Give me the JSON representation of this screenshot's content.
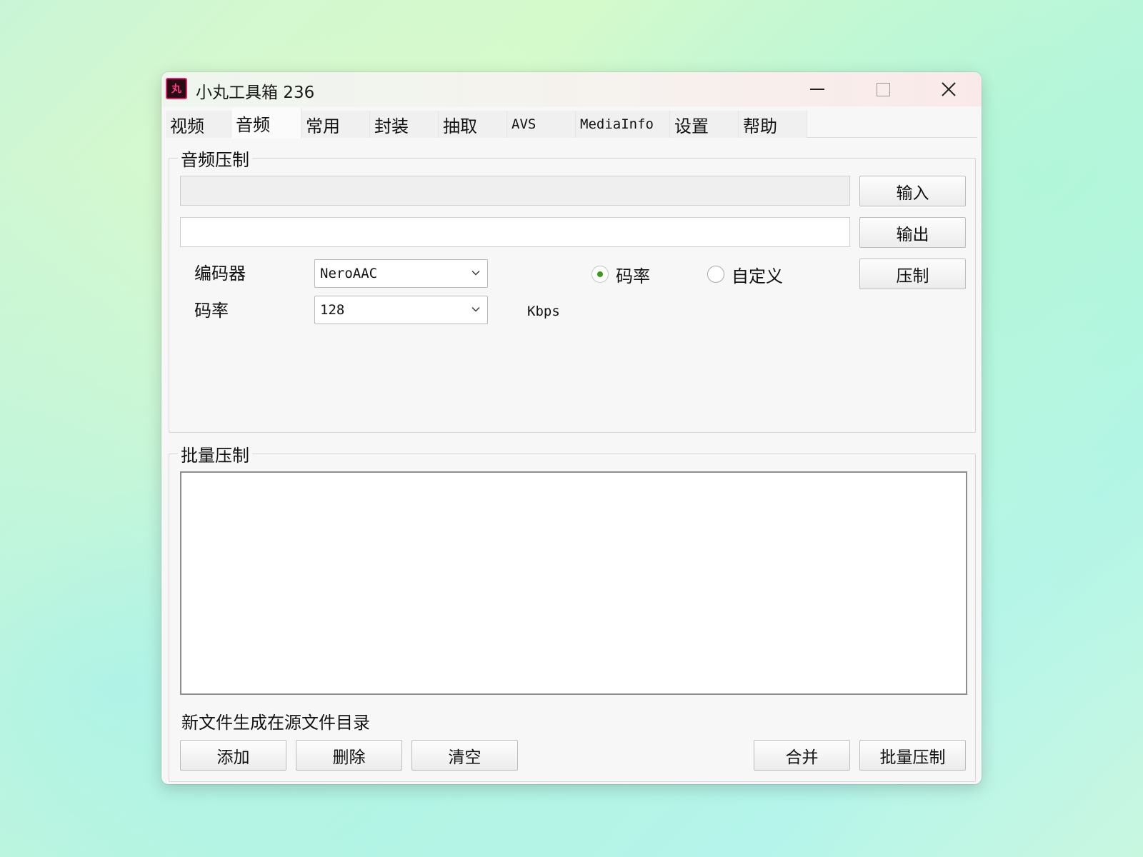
{
  "window": {
    "icon_text": "丸",
    "title": "小丸工具箱 236"
  },
  "tabs": [
    {
      "label": "视频"
    },
    {
      "label": "音频"
    },
    {
      "label": "常用"
    },
    {
      "label": "封装"
    },
    {
      "label": "抽取"
    },
    {
      "label": "AVS"
    },
    {
      "label": "MediaInfo"
    },
    {
      "label": "设置"
    },
    {
      "label": "帮助"
    }
  ],
  "active_tab": "音频",
  "audio_encode": {
    "group_title": "音频压制",
    "input_path": "",
    "output_path": "",
    "input_button": "输入",
    "output_button": "输出",
    "encode_button": "压制",
    "encoder_label": "编码器",
    "encoder_value": "NeroAAC",
    "bitrate_label": "码率",
    "bitrate_value": "128",
    "bitrate_unit": "Kbps",
    "mode_bitrate_label": "码率",
    "mode_custom_label": "自定义",
    "selected_mode": "码率"
  },
  "batch_encode": {
    "group_title": "批量压制",
    "files": [],
    "note": "新文件生成在源文件目录",
    "add_button": "添加",
    "delete_button": "删除",
    "clear_button": "清空",
    "merge_button": "合并",
    "batch_button": "批量压制"
  },
  "colors": {
    "radio_selected": "#3c9a1a",
    "app_icon_accent": "#e0226e"
  }
}
